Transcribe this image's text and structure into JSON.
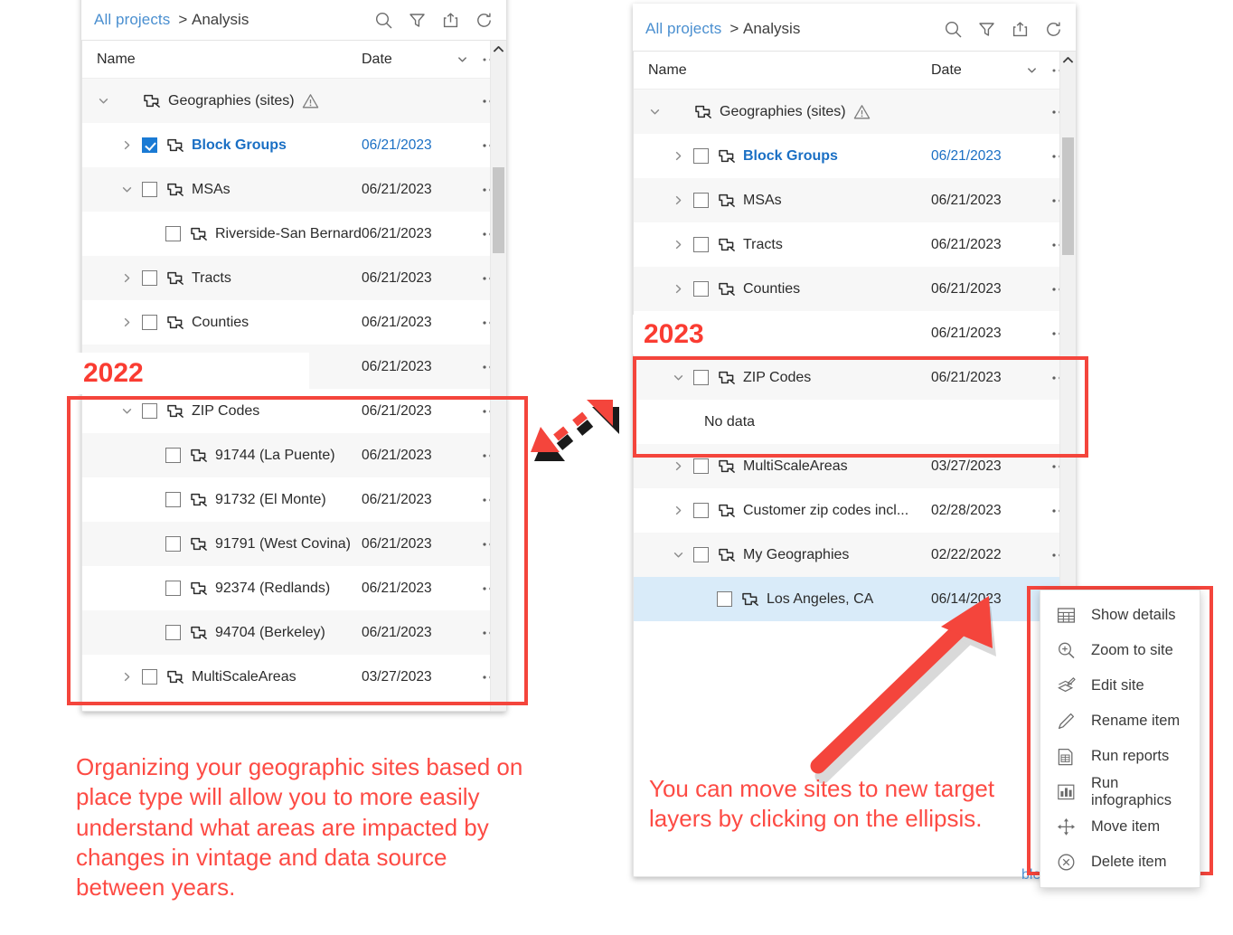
{
  "left_panel": {
    "breadcrumb": {
      "root": "All projects",
      "separator": ">",
      "current": "Analysis"
    },
    "toolbar_icons": [
      "search-icon",
      "filter-icon",
      "share-icon",
      "refresh-icon"
    ],
    "columns": {
      "name": "Name",
      "date": "Date"
    },
    "rows": [
      {
        "name": "Geographies (sites)",
        "date": "",
        "indent": 0,
        "chevron": "down",
        "checkbox": "none",
        "warning": true,
        "bold": false,
        "alt": true
      },
      {
        "name": "Block Groups",
        "date": "06/21/2023",
        "indent": 1,
        "chevron": "right",
        "checkbox": "checked",
        "warning": false,
        "bold": true,
        "alt": false
      },
      {
        "name": "MSAs",
        "date": "06/21/2023",
        "indent": 1,
        "chevron": "down",
        "checkbox": "unchecked",
        "warning": false,
        "bold": false,
        "alt": true
      },
      {
        "name": "Riverside-San Bernardi...",
        "date": "06/21/2023",
        "indent": 2,
        "chevron": "none",
        "checkbox": "unchecked",
        "warning": false,
        "bold": false,
        "alt": false
      },
      {
        "name": "Tracts",
        "date": "06/21/2023",
        "indent": 1,
        "chevron": "right",
        "checkbox": "unchecked",
        "warning": false,
        "bold": false,
        "alt": true
      },
      {
        "name": "Counties",
        "date": "06/21/2023",
        "indent": 1,
        "chevron": "right",
        "checkbox": "unchecked",
        "warning": false,
        "bold": false,
        "alt": false
      },
      {
        "name": "",
        "date": "06/21/2023",
        "indent": 1,
        "chevron": "none",
        "checkbox": "none",
        "warning": false,
        "bold": false,
        "alt": true
      },
      {
        "name": "ZIP Codes",
        "date": "06/21/2023",
        "indent": 1,
        "chevron": "down",
        "checkbox": "unchecked",
        "warning": false,
        "bold": false,
        "alt": false
      },
      {
        "name": "91744 (La Puente)",
        "date": "06/21/2023",
        "indent": 2,
        "chevron": "none",
        "checkbox": "unchecked",
        "warning": false,
        "bold": false,
        "alt": true
      },
      {
        "name": "91732 (El Monte)",
        "date": "06/21/2023",
        "indent": 2,
        "chevron": "none",
        "checkbox": "unchecked",
        "warning": false,
        "bold": false,
        "alt": false
      },
      {
        "name": "91791 (West Covina)",
        "date": "06/21/2023",
        "indent": 2,
        "chevron": "none",
        "checkbox": "unchecked",
        "warning": false,
        "bold": false,
        "alt": true
      },
      {
        "name": "92374 (Redlands)",
        "date": "06/21/2023",
        "indent": 2,
        "chevron": "none",
        "checkbox": "unchecked",
        "warning": false,
        "bold": false,
        "alt": false
      },
      {
        "name": "94704 (Berkeley)",
        "date": "06/21/2023",
        "indent": 2,
        "chevron": "none",
        "checkbox": "unchecked",
        "warning": false,
        "bold": false,
        "alt": true
      },
      {
        "name": "MultiScaleAreas",
        "date": "03/27/2023",
        "indent": 1,
        "chevron": "right",
        "checkbox": "unchecked",
        "warning": false,
        "bold": false,
        "alt": false
      }
    ],
    "year_tag": "2022"
  },
  "right_panel": {
    "breadcrumb": {
      "root": "All projects",
      "separator": ">",
      "current": "Analysis"
    },
    "toolbar_icons": [
      "search-icon",
      "filter-icon",
      "share-icon",
      "refresh-icon"
    ],
    "columns": {
      "name": "Name",
      "date": "Date"
    },
    "rows": [
      {
        "name": "Geographies (sites)",
        "date": "",
        "indent": 0,
        "chevron": "down",
        "checkbox": "none",
        "warning": true,
        "bold": false,
        "alt": true,
        "selected": false
      },
      {
        "name": "Block Groups",
        "date": "06/21/2023",
        "indent": 1,
        "chevron": "right",
        "checkbox": "unchecked",
        "warning": false,
        "bold": true,
        "alt": false,
        "selected": false
      },
      {
        "name": "MSAs",
        "date": "06/21/2023",
        "indent": 1,
        "chevron": "right",
        "checkbox": "unchecked",
        "warning": false,
        "bold": false,
        "alt": true,
        "selected": false
      },
      {
        "name": "Tracts",
        "date": "06/21/2023",
        "indent": 1,
        "chevron": "right",
        "checkbox": "unchecked",
        "warning": false,
        "bold": false,
        "alt": false,
        "selected": false
      },
      {
        "name": "Counties",
        "date": "06/21/2023",
        "indent": 1,
        "chevron": "right",
        "checkbox": "unchecked",
        "warning": false,
        "bold": false,
        "alt": true,
        "selected": false
      },
      {
        "name": "",
        "date": "06/21/2023",
        "indent": 1,
        "chevron": "none",
        "checkbox": "none",
        "warning": false,
        "bold": false,
        "alt": false,
        "selected": false
      },
      {
        "name": "ZIP Codes",
        "date": "06/21/2023",
        "indent": 1,
        "chevron": "down",
        "checkbox": "unchecked",
        "warning": false,
        "bold": false,
        "alt": true,
        "selected": false
      },
      {
        "name": "No data",
        "date": "",
        "indent": 0,
        "chevron": "none",
        "checkbox": "none",
        "warning": false,
        "bold": false,
        "alt": false,
        "selected": false,
        "nodata": true
      },
      {
        "name": "MultiScaleAreas",
        "date": "03/27/2023",
        "indent": 1,
        "chevron": "right",
        "checkbox": "unchecked",
        "warning": false,
        "bold": false,
        "alt": true,
        "selected": false
      },
      {
        "name": "Customer zip codes incl...",
        "date": "02/28/2023",
        "indent": 1,
        "chevron": "right",
        "checkbox": "unchecked",
        "warning": false,
        "bold": false,
        "alt": false,
        "selected": false
      },
      {
        "name": "My Geographies",
        "date": "02/22/2022",
        "indent": 1,
        "chevron": "down",
        "checkbox": "unchecked",
        "warning": false,
        "bold": false,
        "alt": true,
        "selected": false
      },
      {
        "name": "Los Angeles, CA",
        "date": "06/14/2023",
        "indent": 2,
        "chevron": "none",
        "checkbox": "unchecked",
        "warning": false,
        "bold": false,
        "alt": false,
        "selected": true,
        "dots_focused": true
      }
    ],
    "year_tag": "2023",
    "obscured_text": "ble"
  },
  "context_menu": {
    "items": [
      {
        "label": "Show details",
        "icon": "table-icon"
      },
      {
        "label": "Zoom to site",
        "icon": "zoom-in-icon"
      },
      {
        "label": "Edit site",
        "icon": "edit-layers-icon"
      },
      {
        "label": "Rename item",
        "icon": "pencil-icon"
      },
      {
        "label": "Run reports",
        "icon": "report-icon"
      },
      {
        "label": "Run infographics",
        "icon": "bar-chart-icon"
      },
      {
        "label": "Move item",
        "icon": "move-icon"
      },
      {
        "label": "Delete item",
        "icon": "delete-circle-icon"
      }
    ]
  },
  "annotations": {
    "caption_left": "Organizing your geographic sites based on place type will allow you to more easily understand what areas are impacted by changes in vintage and data source between years.",
    "caption_right": "You can move sites to new target layers by clicking on the ellipsis.",
    "accent_red": "#fd4b44",
    "box_red": "#f4453c",
    "link_blue": "#4a8fd0",
    "selection_blue": "#d9ebf9"
  }
}
